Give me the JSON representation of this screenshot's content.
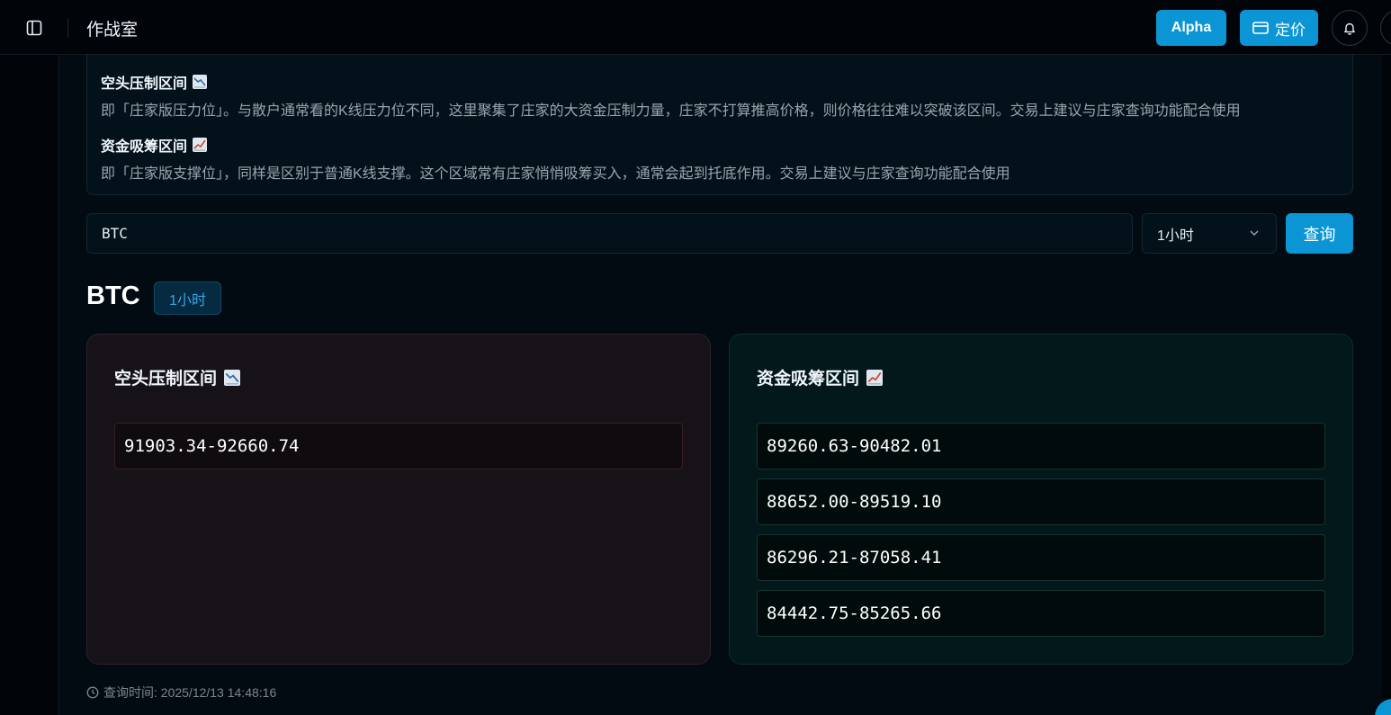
{
  "header": {
    "title": "作战室",
    "alpha_label": "Alpha",
    "pricing_label": "定价"
  },
  "info": {
    "short": {
      "title": "空头压制区间",
      "icon": "chart-decreasing-icon",
      "description": "即「庄家版压力位」。与散户通常看的K线压力位不同，这里聚集了庄家的大资金压制力量，庄家不打算推高价格，则价格往往难以突破该区间。交易上建议与庄家查询功能配合使用"
    },
    "long": {
      "title": "资金吸筹区间",
      "icon": "chart-increasing-icon",
      "description": "即「庄家版支撑位」，同样是区别于普通K线支撑。这个区域常有庄家悄悄吸筹买入，通常会起到托底作用。交易上建议与庄家查询功能配合使用"
    }
  },
  "search": {
    "symbol_value": "BTC",
    "interval_value": "1小时",
    "query_label": "查询"
  },
  "result": {
    "symbol": "BTC",
    "interval": "1小时",
    "short_card": {
      "title": "空头压制区间",
      "ranges": [
        "91903.34-92660.74"
      ]
    },
    "long_card": {
      "title": "资金吸筹区间",
      "ranges": [
        "89260.63-90482.01",
        "88652.00-89519.10",
        "86296.21-87058.41",
        "84442.75-85265.66"
      ]
    },
    "query_time": "查询时间: 2025/12/13 14:48:16"
  },
  "colors": {
    "accent": "#0b95d4",
    "background": "#010409",
    "short_card_bg": "#161218",
    "long_card_bg": "#03181a"
  }
}
